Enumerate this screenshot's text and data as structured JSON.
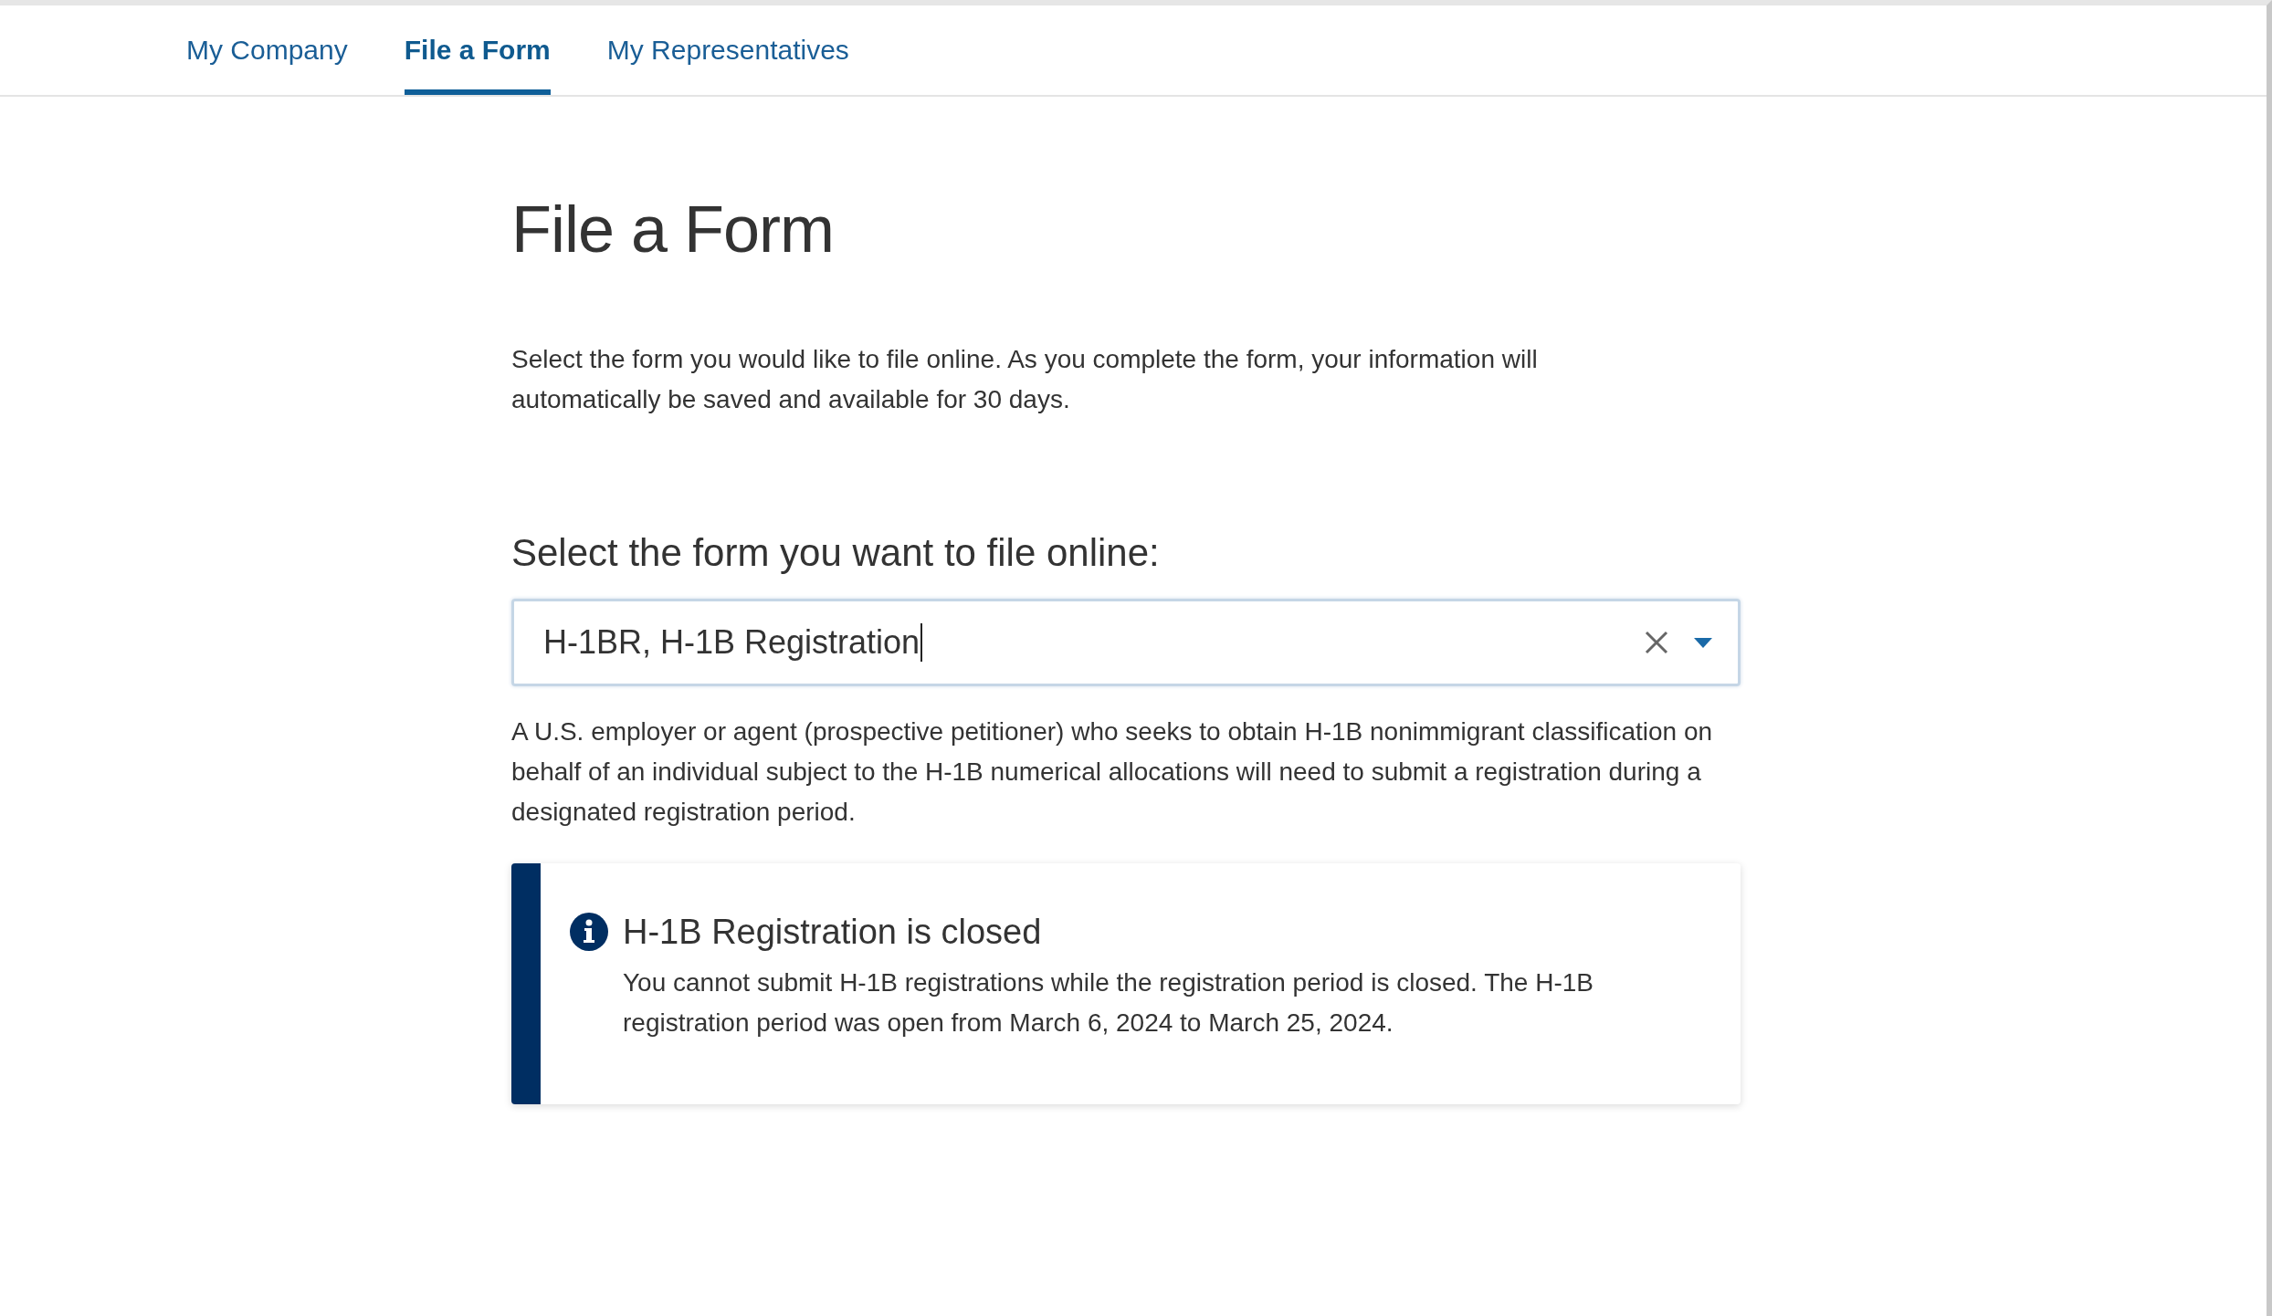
{
  "tabs": [
    {
      "label": "My Company",
      "selected": false
    },
    {
      "label": "File a Form",
      "selected": true
    },
    {
      "label": "My Representatives",
      "selected": false
    }
  ],
  "heading": "File a Form",
  "intro": "Select the form you would like to file online. As you complete the form, your information will automatically be saved and available for 30 days.",
  "form_select": {
    "label": "Select the form you want to file online:",
    "value": "H-1BR, H-1B Registration"
  },
  "description": "A U.S. employer or agent (prospective petitioner) who seeks to obtain H-1B nonimmigrant classification on behalf of an individual subject to the H-1B numerical allocations will need to submit a registration during a designated registration period.",
  "alert": {
    "title": "H-1B Registration is closed",
    "body": "You cannot submit H-1B registrations while the registration period is closed. The H-1B registration period was open from March 6, 2024 to March 25, 2024."
  }
}
